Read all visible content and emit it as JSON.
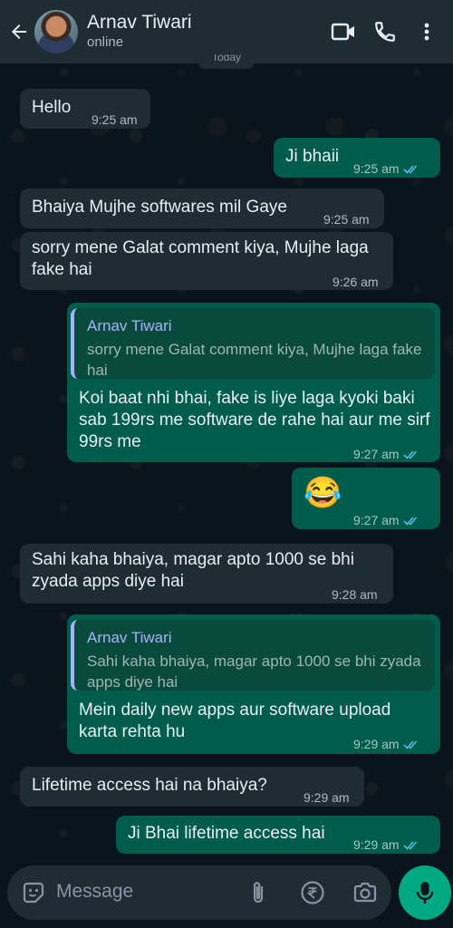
{
  "header": {
    "contact_name": "Arnav Tiwari",
    "status": "online",
    "icons": [
      "back-arrow-icon",
      "video-call-icon",
      "voice-call-icon",
      "more-vert-icon"
    ]
  },
  "date_chip": "Today",
  "messages": [
    {
      "dir": "in",
      "text": "Hello",
      "time": "9:25 am"
    },
    {
      "dir": "out",
      "text": "Ji bhaii",
      "time": "9:25 am",
      "read": true
    },
    {
      "dir": "in",
      "text": "Bhaiya Mujhe softwares mil Gaye",
      "time": "9:25 am"
    },
    {
      "dir": "in",
      "text": "sorry mene Galat comment kiya, Mujhe laga fake hai",
      "time": "9:26 am"
    },
    {
      "dir": "out",
      "quote": {
        "name": "Arnav Tiwari",
        "text": "sorry mene Galat comment kiya, Mujhe laga fake hai"
      },
      "text": "Koi baat nhi bhai, fake is liye laga kyoki baki sab 199rs me software de rahe hai aur me sirf 99rs me",
      "time": "9:27 am",
      "read": true
    },
    {
      "dir": "out",
      "text": "😂",
      "time": "9:27 am",
      "read": true
    },
    {
      "dir": "in",
      "text": "Sahi kaha bhaiya, magar apto 1000 se bhi zyada apps diye hai",
      "time": "9:28 am"
    },
    {
      "dir": "out",
      "quote": {
        "name": "Arnav Tiwari",
        "text": "Sahi kaha bhaiya, magar apto 1000 se bhi zyada apps diye hai"
      },
      "text": "Mein daily new apps aur software upload karta rehta hu",
      "time": "9:29 am",
      "read": true
    },
    {
      "dir": "in",
      "text": "Lifetime access hai na bhaiya?",
      "time": "9:29 am"
    },
    {
      "dir": "out",
      "text": "Ji Bhai lifetime access hai",
      "time": "9:29 am",
      "read": true
    }
  ],
  "composer": {
    "placeholder": "Message",
    "icons": [
      "sticker-icon",
      "attach-icon",
      "rupee-payment-icon",
      "camera-icon",
      "mic-icon"
    ]
  },
  "colors": {
    "header_bg": "#1f2c34",
    "incoming_bubble": "#1f2c34",
    "outgoing_bubble": "#005c4b",
    "read_ticks": "#53bdeb",
    "accent": "#00a884"
  }
}
